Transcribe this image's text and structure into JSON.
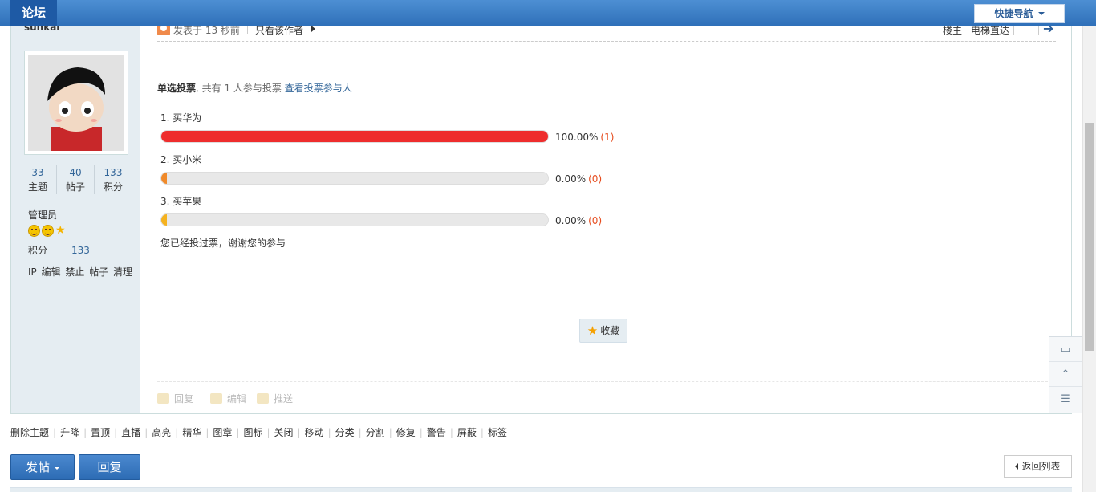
{
  "topbar": {
    "brand": "论坛",
    "quick_nav": "快捷导航"
  },
  "user": {
    "name": "sunkai",
    "stats": [
      {
        "value": "33",
        "label": "主题"
      },
      {
        "value": "40",
        "label": "帖子"
      },
      {
        "value": "133",
        "label": "积分"
      }
    ],
    "group": "管理员",
    "points_label": "积分",
    "points_value": "133",
    "admin_links": "IP 编辑 禁止 帖子 清理"
  },
  "meta": {
    "posted": "发表于 13 秒前",
    "only_author": "只看该作者",
    "floor": "楼主",
    "elevator": "电梯直达"
  },
  "poll": {
    "type_label": "单选投票",
    "summary": ", 共有 1 人参与投票",
    "view_voters": "查看投票参与人",
    "options": [
      {
        "label": "1.  买华为",
        "percent": "100.00%",
        "count": "(1)",
        "fraction": 1.0,
        "color": "#ee2d2d"
      },
      {
        "label": "2.  买小米",
        "percent": "0.00%",
        "count": "(0)",
        "fraction": 0.0,
        "color": "#f08a2a"
      },
      {
        "label": "3.  买苹果",
        "percent": "0.00%",
        "count": "(0)",
        "fraction": 0.0,
        "color": "#f5b21f"
      }
    ],
    "voted_msg": "您已经投过票，谢谢您的参与"
  },
  "favorite": "收藏",
  "actions": {
    "reply": "回复",
    "edit": "编辑",
    "push": "推送"
  },
  "moderation": [
    "删除主题",
    "升降",
    "置顶",
    "直播",
    "高亮",
    "精华",
    "图章",
    "图标",
    "关闭",
    "移动",
    "分类",
    "分割",
    "修复",
    "警告",
    "屏蔽",
    "标签"
  ],
  "buttons": {
    "post": "发帖",
    "reply": "回复",
    "back": "返回列表"
  }
}
